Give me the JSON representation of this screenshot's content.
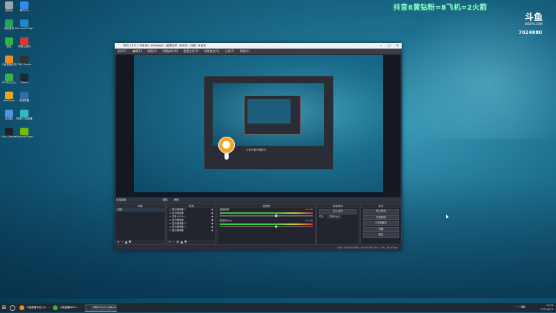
{
  "overlay": {
    "promo_text": "抖音8黄钻粉=8飞机=2火箭",
    "brand": "斗鱼",
    "brand_sub": "DOUYU.COM",
    "room_number": "7024880"
  },
  "desktop_icons": [
    {
      "label": "回收站",
      "color": "#9aa4ad"
    },
    {
      "label": "腾讯QQ",
      "color": "#2d8cf0"
    },
    {
      "label": "电脑管家",
      "color": "#2aa15a"
    },
    {
      "label": "Microsoft Edge",
      "color": "#1e88c9"
    },
    {
      "label": "微信",
      "color": "#2fb344"
    },
    {
      "label": "网易云音乐",
      "color": "#d23a3a"
    },
    {
      "label": "斗鱼直播伴侣",
      "color": "#f08a24"
    },
    {
      "label": "OBS Studio",
      "color": "#333"
    },
    {
      "label": "360安全卫士",
      "color": "#3cae4b"
    },
    {
      "label": "Steam",
      "color": "#1b2838"
    },
    {
      "label": "WeGame",
      "color": "#e5a823"
    },
    {
      "label": "英雄联盟",
      "color": "#2b6fae"
    },
    {
      "label": "此电脑",
      "color": "#4b96d6"
    },
    {
      "label": "网易UU加速器",
      "color": "#2fb8c7"
    },
    {
      "label": "Epic Games",
      "color": "#222"
    },
    {
      "label": "GeForce Experience",
      "color": "#76b900"
    }
  ],
  "obs": {
    "title": "OBS 27.0.1 (64-bit, windows) - 配置文件: 未命名 - 场景: 未命名",
    "menu": [
      "文件(F)",
      "编辑(E)",
      "视图(V)",
      "停靠部件(D)",
      "配置文件(P)",
      "场景集合(S)",
      "工具(T)",
      "帮助(H)"
    ],
    "dock_bar_label": "未选择源",
    "dock_bar_buttons": [
      "属性",
      "滤镜"
    ],
    "scenes_header": "场景",
    "scenes": [
      "场景"
    ],
    "sources_header": "来源",
    "sources": [
      "显示器采集 2",
      "显示器采集",
      "文本 (GDI+)",
      "显示器采集",
      "显示器采集 2",
      "显示器采集 2",
      "显示器采集"
    ],
    "mixer_header": "混音器",
    "mixer_tracks": [
      {
        "name": "桌面音频",
        "db": "0.0 dB"
      },
      {
        "name": "麦克风/Aux",
        "db": "0.0 dB"
      }
    ],
    "transition_header": "转场特效",
    "transition_type": "淡入淡出",
    "duration_label": "时长",
    "duration_value": "300 ms",
    "controls_header": "控件",
    "controls": [
      "停止推流",
      "开始录制",
      "工作室模式",
      "设置",
      "退出"
    ],
    "status": "LIVE: 00:00:00    REC: 00:00:00    CPU: 1.9%, 30.00 fps"
  },
  "preview": {
    "nested_title": "斗鱼开播/开播助手"
  },
  "taskbar": {
    "apps": [
      {
        "label": "斗鱼直播伴侣 (0) - ...",
        "color": "#f08a24"
      },
      {
        "label": "斗鱼直播间Giv...",
        "color": "#3cae4b"
      },
      {
        "label": "OBS 27.0.1 (64-bi...",
        "color": "#333"
      }
    ],
    "time": "14:58",
    "date": "2021/8/29"
  }
}
